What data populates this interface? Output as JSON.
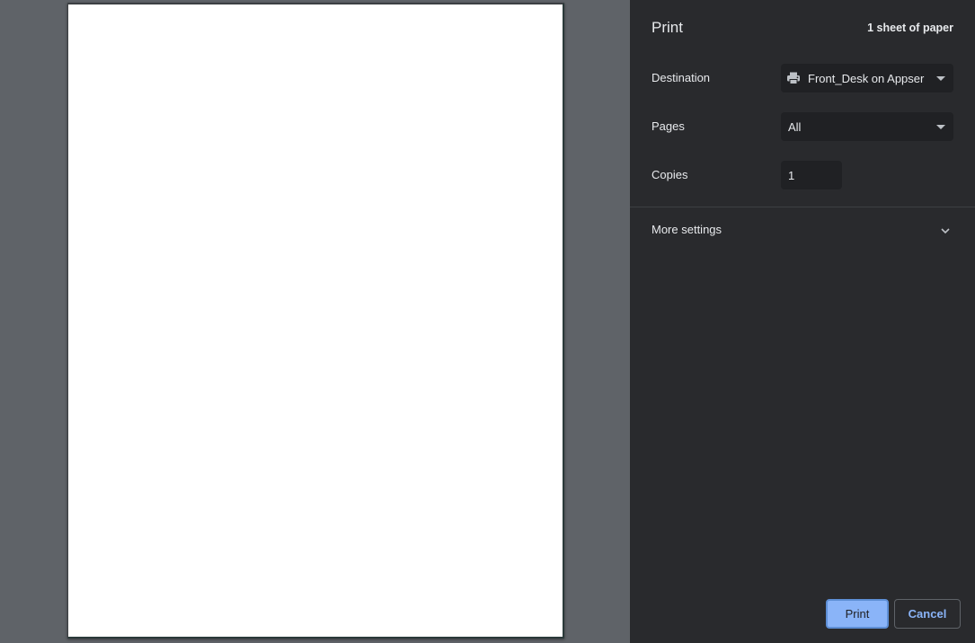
{
  "header": {
    "title": "Print",
    "sheet_count": "1 sheet of paper"
  },
  "destination": {
    "label": "Destination",
    "value": "Front_Desk on Appser",
    "icon": "printer-icon"
  },
  "pages": {
    "label": "Pages",
    "value": "All"
  },
  "copies": {
    "label": "Copies",
    "value": "1"
  },
  "more_settings": {
    "label": "More settings",
    "icon": "chevron-down-icon"
  },
  "buttons": {
    "print": "Print",
    "cancel": "Cancel"
  },
  "colors": {
    "preview_background": "#5f6368",
    "sidebar_background": "#292a2d",
    "field_background": "#202124",
    "accent": "#8ab4f8",
    "text": "#e8eaed"
  }
}
